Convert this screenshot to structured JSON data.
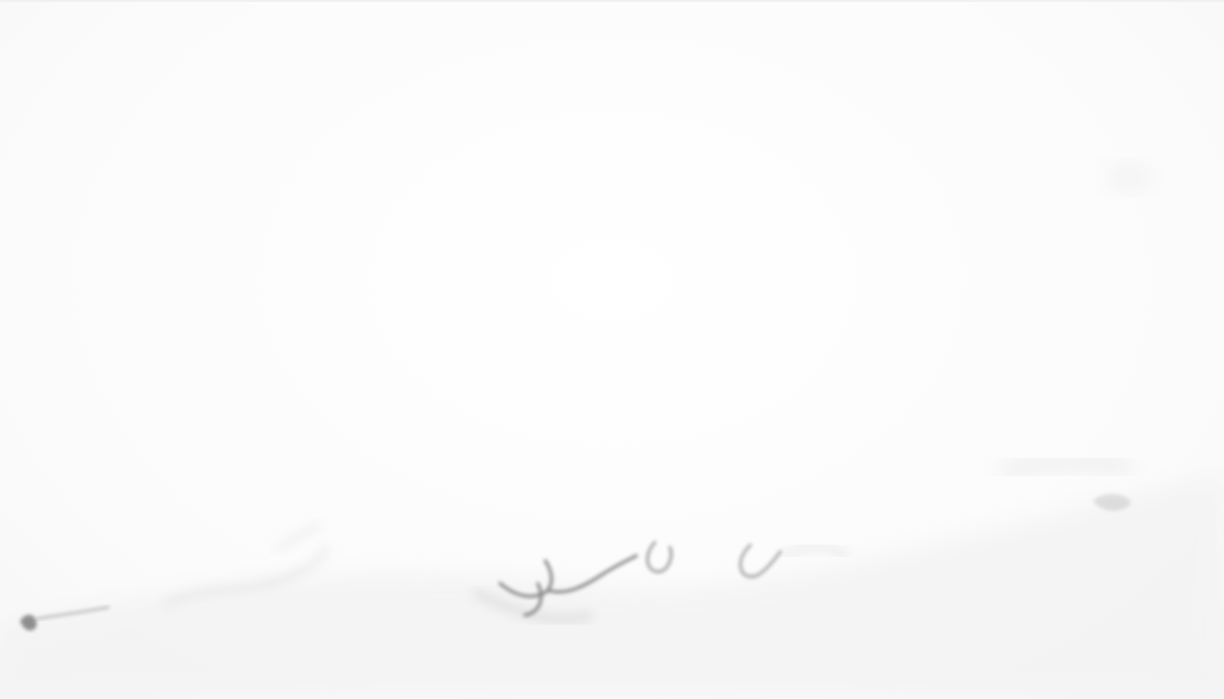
{
  "scene": {
    "description_visible_text": "",
    "colors": {
      "background": "#fdfdfd",
      "smudge_dark": "#3a3a3a",
      "smudge_mid": "#9a9a9a",
      "smudge_light": "#d6d6d6"
    },
    "icons": []
  }
}
